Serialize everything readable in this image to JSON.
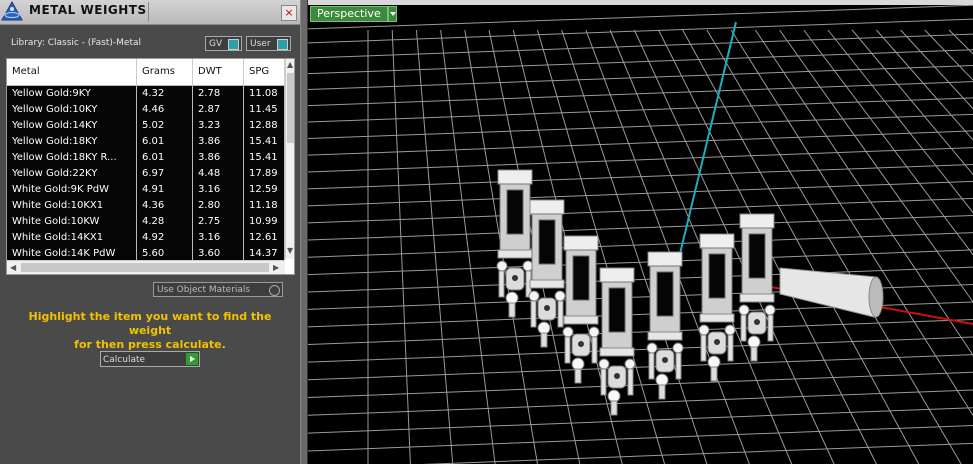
{
  "panel": {
    "title": "METAL WEIGHTS",
    "close": "×",
    "library_label": "Library: Classic - (Fast)-Metal",
    "toggle_gv": "GV",
    "toggle_user": "User",
    "columns": [
      "Metal",
      "Grams",
      "DWT",
      "SPG"
    ],
    "rows": [
      [
        "Yellow Gold:9KY",
        "4.32",
        "2.78",
        "11.08"
      ],
      [
        "Yellow Gold:10KY",
        "4.46",
        "2.87",
        "11.45"
      ],
      [
        "Yellow Gold:14KY",
        "5.02",
        "3.23",
        "12.88"
      ],
      [
        "Yellow Gold:18KY",
        "6.01",
        "3.86",
        "15.41"
      ],
      [
        "Yellow Gold:18KY R...",
        "6.01",
        "3.86",
        "15.41"
      ],
      [
        "Yellow Gold:22KY",
        "6.97",
        "4.48",
        "17.89"
      ],
      [
        "White Gold:9K PdW",
        "4.91",
        "3.16",
        "12.59"
      ],
      [
        "White Gold:10KX1",
        "4.36",
        "2.80",
        "11.18"
      ],
      [
        "White Gold:10KW",
        "4.28",
        "2.75",
        "10.99"
      ],
      [
        "White Gold:14KX1",
        "4.92",
        "3.16",
        "12.61"
      ],
      [
        "White Gold:14K PdW",
        "5.60",
        "3.60",
        "14.37"
      ]
    ],
    "use_object_materials": "Use Object Materials",
    "hint_line1": "Highlight the item you want to find the weight",
    "hint_line2": "for then press calculate.",
    "calculate": "Calculate",
    "hint_color": "#f2c200"
  },
  "viewport": {
    "view_name": "Perspective",
    "axis_colors": {
      "y": "#1ab0c0",
      "x": "#d01010"
    }
  }
}
